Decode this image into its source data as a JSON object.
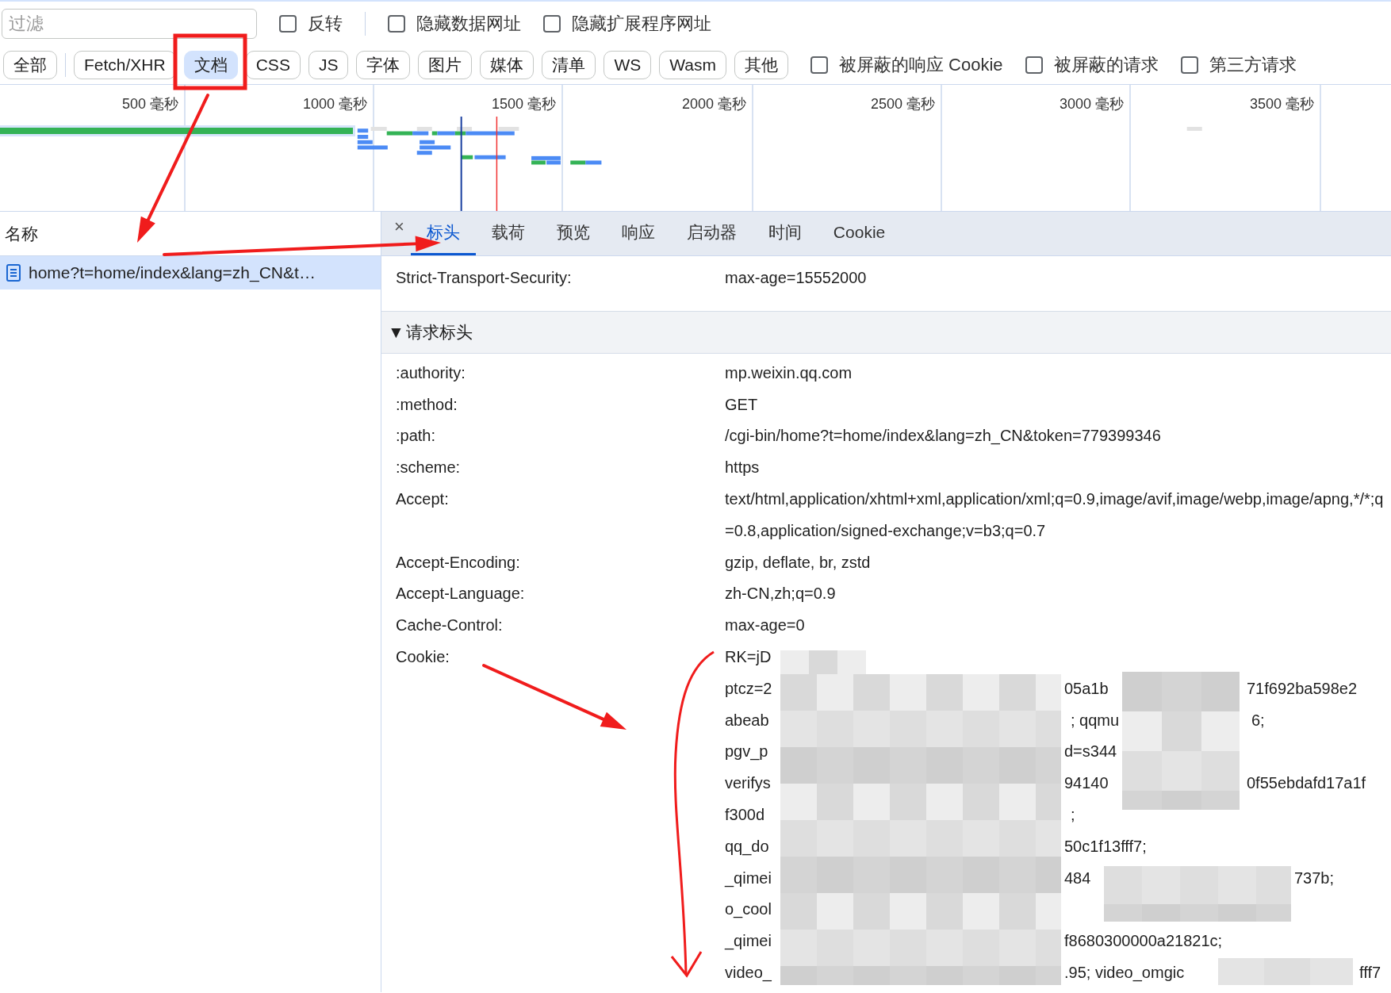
{
  "filter": {
    "placeholder": "过滤"
  },
  "toolbar_checks": [
    {
      "label": "反转",
      "checked": false
    },
    {
      "label": "隐藏数据网址",
      "checked": false
    },
    {
      "label": "隐藏扩展程序网址",
      "checked": false
    }
  ],
  "type_filters": [
    {
      "label": "全部",
      "selected": false
    },
    {
      "label": "Fetch/XHR",
      "selected": false
    },
    {
      "label": "文档",
      "selected": true
    },
    {
      "label": "CSS",
      "selected": false
    },
    {
      "label": "JS",
      "selected": false
    },
    {
      "label": "字体",
      "selected": false
    },
    {
      "label": "图片",
      "selected": false
    },
    {
      "label": "媒体",
      "selected": false
    },
    {
      "label": "清单",
      "selected": false
    },
    {
      "label": "WS",
      "selected": false
    },
    {
      "label": "Wasm",
      "selected": false
    },
    {
      "label": "其他",
      "selected": false
    }
  ],
  "type_checks": [
    {
      "label": "被屏蔽的响应 Cookie",
      "checked": false
    },
    {
      "label": "被屏蔽的请求",
      "checked": false
    },
    {
      "label": "第三方请求",
      "checked": false
    }
  ],
  "timeline": {
    "ticks": [
      "500 毫秒",
      "1000 毫秒",
      "1500 毫秒",
      "2000 毫秒",
      "2500 毫秒",
      "3000 毫秒",
      "3500 毫秒"
    ]
  },
  "requests": {
    "column": "名称",
    "rows": [
      {
        "name": "home?t=home/index&lang=zh_CN&t…",
        "selected": true
      }
    ]
  },
  "details": {
    "close": "×",
    "tabs": [
      {
        "label": "标头",
        "selected": true
      },
      {
        "label": "载荷",
        "selected": false
      },
      {
        "label": "预览",
        "selected": false
      },
      {
        "label": "响应",
        "selected": false
      },
      {
        "label": "启动器",
        "selected": false
      },
      {
        "label": "时间",
        "selected": false
      },
      {
        "label": "Cookie",
        "selected": false
      }
    ],
    "response_headers": [
      {
        "name": "Strict-Transport-Security:",
        "value": "max-age=15552000"
      }
    ],
    "request_section": {
      "toggle": "▼",
      "title": "请求标头"
    },
    "request_headers": [
      {
        "name": ":authority:",
        "value": "mp.weixin.qq.com"
      },
      {
        "name": ":method:",
        "value": "GET"
      },
      {
        "name": ":path:",
        "value": "/cgi-bin/home?t=home/index&lang=zh_CN&token=779399346"
      },
      {
        "name": ":scheme:",
        "value": "https"
      },
      {
        "name": "Accept:",
        "value": "text/html,application/xhtml+xml,application/xml;q=0.9,image/avif,image/webp,image/apng,*/*;q=0.8,application/signed-exchange;v=b3;q=0.7"
      },
      {
        "name": "Accept-Encoding:",
        "value": "gzip, deflate, br, zstd"
      },
      {
        "name": "Accept-Language:",
        "value": "zh-CN,zh;q=0.9"
      },
      {
        "name": "Cache-Control:",
        "value": "max-age=0"
      }
    ],
    "cookie": {
      "name": "Cookie:",
      "lines": [
        [
          "RK=jD"
        ],
        [
          "ptcz=2",
          "05a1b",
          "71f692ba598e2"
        ],
        [
          "abeab",
          "; qqmu",
          "6;"
        ],
        [
          "pgv_p",
          "d=s344"
        ],
        [
          "verifys",
          "94140",
          "0f55ebdafd17a1f"
        ],
        [
          "f300d",
          ";"
        ],
        [
          "qq_do",
          "50c1f13fff7;"
        ],
        [
          "_qimei",
          "484",
          "737b;"
        ],
        [
          "o_cool"
        ],
        [
          "_qimei",
          "f8680300000a21821c;"
        ],
        [
          "video_",
          ".95; video_omgic",
          "fff7"
        ]
      ]
    }
  }
}
